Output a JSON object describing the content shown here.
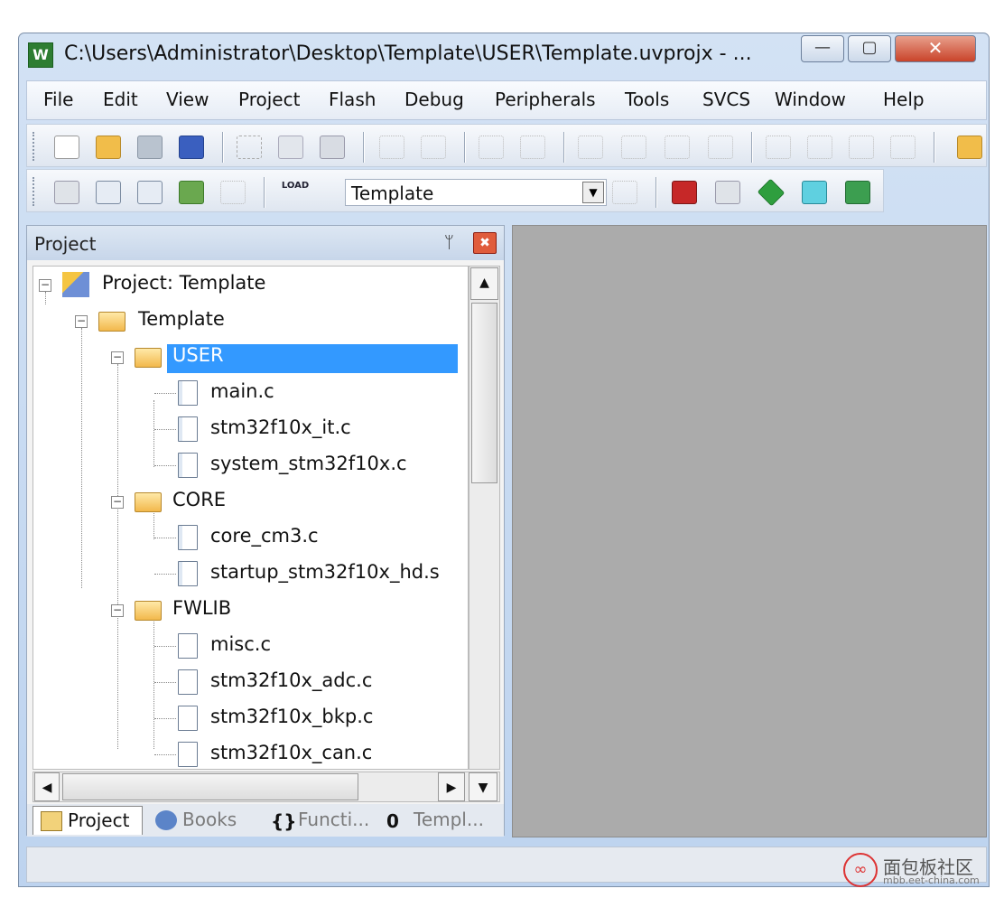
{
  "window": {
    "title": "C:\\Users\\Administrator\\Desktop\\Template\\USER\\Template.uvprojx - ...",
    "app_icon": "W",
    "minimize": "—",
    "maximize": "▢",
    "close": "✕"
  },
  "menu": [
    "File",
    "Edit",
    "View",
    "Project",
    "Flash",
    "Debug",
    "Peripherals",
    "Tools",
    "SVCS",
    "Window",
    "Help"
  ],
  "toolbar2": {
    "load_label": "LOAD",
    "target_select": "Template"
  },
  "panel": {
    "title": "Project",
    "pin": "ᛘ",
    "close": "✖"
  },
  "tree": {
    "root": "Project: Template",
    "target": "Template",
    "groups": [
      {
        "name": "USER",
        "files": [
          "main.c",
          "stm32f10x_it.c",
          "system_stm32f10x.c"
        ]
      },
      {
        "name": "CORE",
        "files": [
          "core_cm3.c",
          "startup_stm32f10x_hd.s"
        ]
      },
      {
        "name": "FWLIB",
        "files": [
          "misc.c",
          "stm32f10x_adc.c",
          "stm32f10x_bkp.c",
          "stm32f10x_can.c"
        ]
      }
    ],
    "selected": "USER"
  },
  "tabs": [
    {
      "label": "Project",
      "icon": "project-icon"
    },
    {
      "label": "Books",
      "icon": "books-icon"
    },
    {
      "label": "Functi...",
      "icon": "functions-icon",
      "glyph": "{}"
    },
    {
      "label": "Templ...",
      "icon": "templates-icon",
      "glyph": "0"
    }
  ],
  "watermark": {
    "symbol": "∞",
    "text": "面包板社区",
    "url": "mbb.eet-china.com"
  }
}
